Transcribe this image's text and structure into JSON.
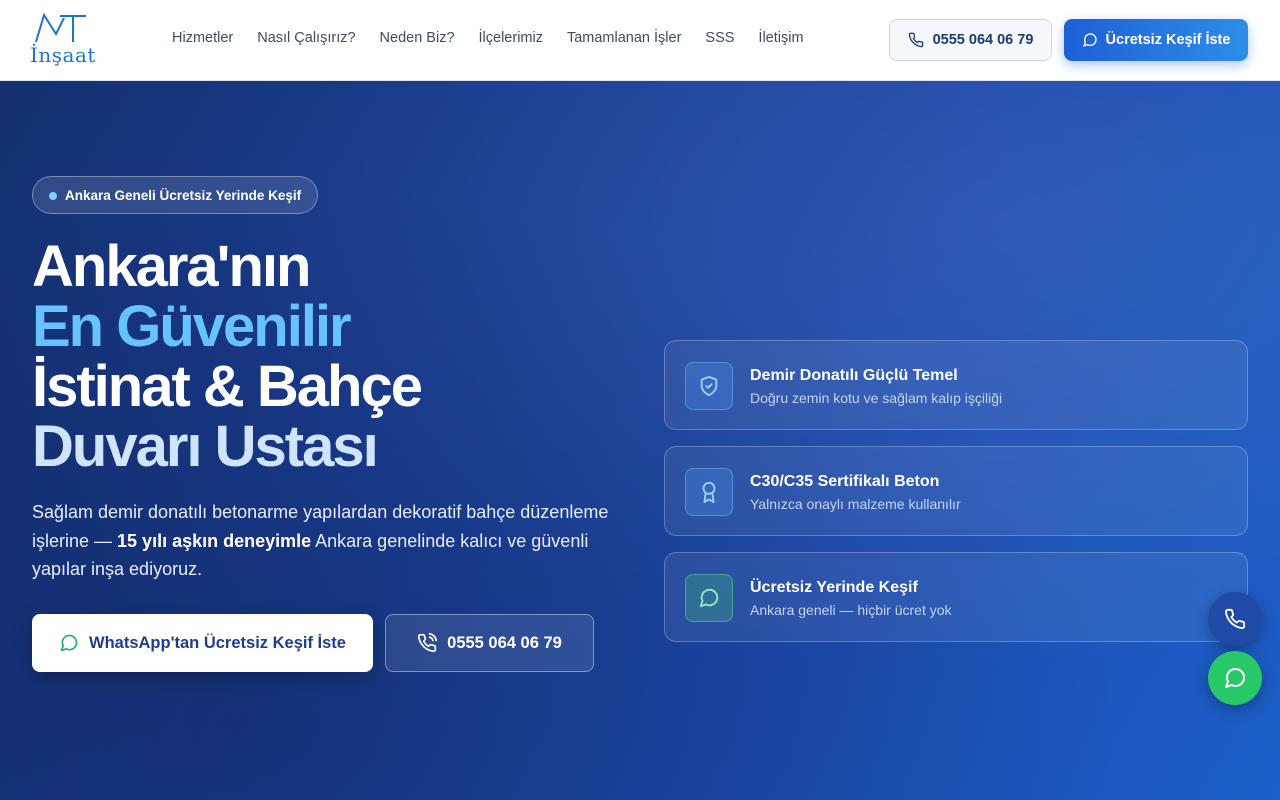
{
  "brand": {
    "logo_mark": "MT",
    "logo_text": "İnşaat"
  },
  "nav": {
    "items": [
      {
        "label": "Hizmetler"
      },
      {
        "label": "Nasıl Çalışırız?"
      },
      {
        "label": "Neden Biz?"
      },
      {
        "label": "İlçelerimiz"
      },
      {
        "label": "Tamamlanan İşler"
      },
      {
        "label": "SSS"
      },
      {
        "label": "İletişim"
      }
    ]
  },
  "header": {
    "phone_label": "0555 064 06 79",
    "phone_icon": "phone-icon",
    "cta_label": "Ücretsiz Keşif İste",
    "cta_icon": "chat-icon"
  },
  "hero": {
    "badge": "Ankara Geneli Ücretsiz Yerinde Keşif",
    "headline": {
      "line1": "Ankara'nın",
      "line2": "En Güvenilir",
      "line3": "İstinat & Bahçe",
      "line4": "Duvarı Ustası"
    },
    "description": {
      "part1": "Sağlam demir donatılı betonarme yapılardan dekoratif bahçe düzenleme işlerine — ",
      "bold": "15 yılı aşkın deneyimle",
      "part2": " Ankara genelinde kalıcı ve güvenli yapılar inşa ediyoruz."
    },
    "whatsapp_button": "WhatsApp'tan Ücretsiz Keşif İste",
    "phone_button": "0555 064 06 79"
  },
  "features": [
    {
      "title": "Demir Donatılı Güçlü Temel",
      "subtitle": "Doğru zemin kotu ve sağlam kalıp işçiliği",
      "icon": "shield-check-icon"
    },
    {
      "title": "C30/C35 Sertifikalı Beton",
      "subtitle": "Yalnızca onaylı malzeme kullanılır",
      "icon": "award-icon"
    },
    {
      "title": "Ücretsiz Yerinde Keşif",
      "subtitle": "Ankara geneli — hiçbir ücret yok",
      "icon": "chat-icon"
    }
  ],
  "colors": {
    "accent": "#1e5fd6",
    "hero_bg": "#1b3f95",
    "highlight": "#66c3ff",
    "whatsapp": "#28c767"
  }
}
